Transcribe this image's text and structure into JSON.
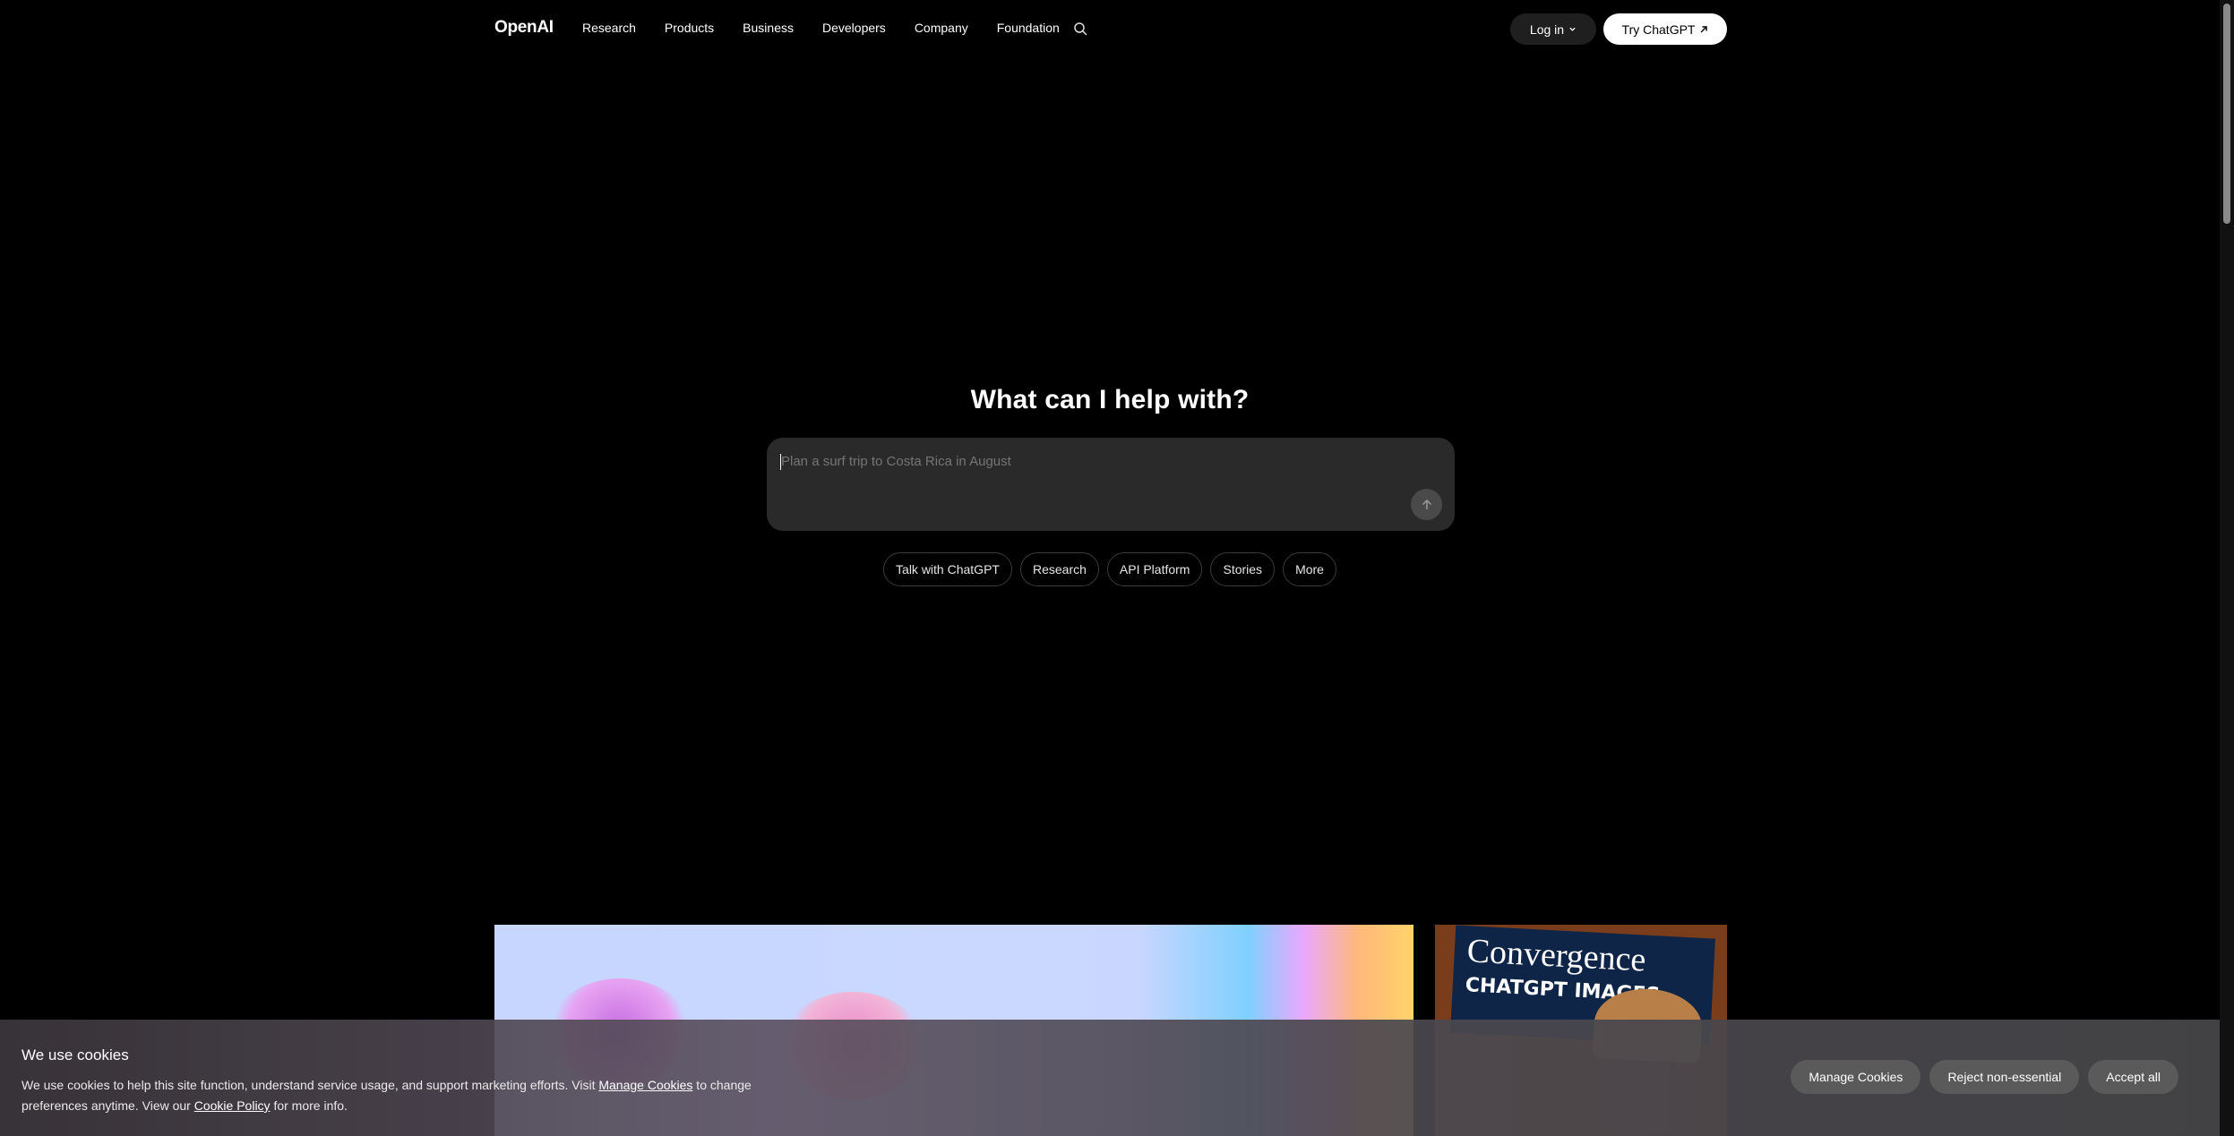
{
  "header": {
    "logo": "OpenAI",
    "nav": [
      "Research",
      "Products",
      "Business",
      "Developers",
      "Company",
      "Foundation"
    ],
    "login_label": "Log in",
    "try_label": "Try ChatGPT"
  },
  "hero": {
    "title": "What can I help with?",
    "prompt_placeholder": "Plan a surf trip to Costa Rica in August",
    "chips": [
      "Talk with ChatGPT",
      "Research",
      "API Platform",
      "Stories",
      "More"
    ]
  },
  "cards": {
    "side_magazine_title": "Convergence",
    "side_magazine_sub": "CHATGPT IMAGES"
  },
  "cookie_banner": {
    "title": "We use cookies",
    "text_1": "We use cookies to help this site function, understand service usage, and support marketing efforts. Visit ",
    "link_manage": "Manage Cookies",
    "text_2": " to change preferences anytime. View our ",
    "link_policy": "Cookie Policy",
    "text_3": " for more info.",
    "buttons": [
      "Manage Cookies",
      "Reject non-essential",
      "Accept all"
    ]
  }
}
